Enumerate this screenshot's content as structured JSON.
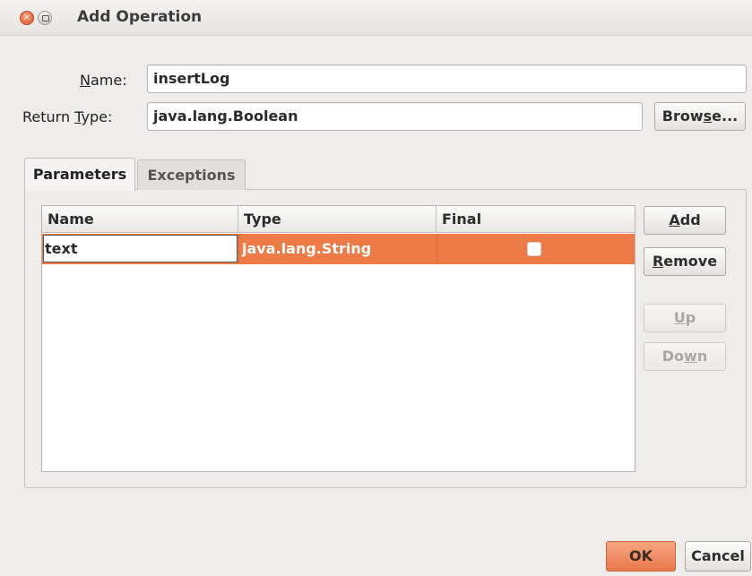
{
  "window": {
    "title": "Add Operation",
    "close_glyph": "×"
  },
  "form": {
    "name_label_underlined": "N",
    "name_label_rest": "ame:",
    "name_value": "insertLog",
    "return_label_prefix": "Return ",
    "return_label_underlined": "T",
    "return_label_rest": "ype:",
    "return_value": "java.lang.Boolean",
    "browse_prefix": "Brow",
    "browse_underlined": "s",
    "browse_rest": "e..."
  },
  "tabs": [
    {
      "label": "Parameters",
      "active": true
    },
    {
      "label": "Exceptions",
      "active": false
    }
  ],
  "table": {
    "columns": [
      "Name",
      "Type",
      "Final"
    ],
    "rows": [
      {
        "name": "text",
        "type": "java.lang.String",
        "final": false,
        "selected": true
      }
    ]
  },
  "side_buttons": {
    "add_underlined": "A",
    "add_rest": "dd",
    "remove_underlined": "R",
    "remove_rest": "emove",
    "up_underlined": "U",
    "up_rest": "p",
    "down_prefix": "Do",
    "down_underlined": "w",
    "down_rest": "n"
  },
  "footer": {
    "ok_label": "OK",
    "cancel_label": "Cancel"
  },
  "colors": {
    "accent": "#ee7a45",
    "background": "#efedea"
  }
}
